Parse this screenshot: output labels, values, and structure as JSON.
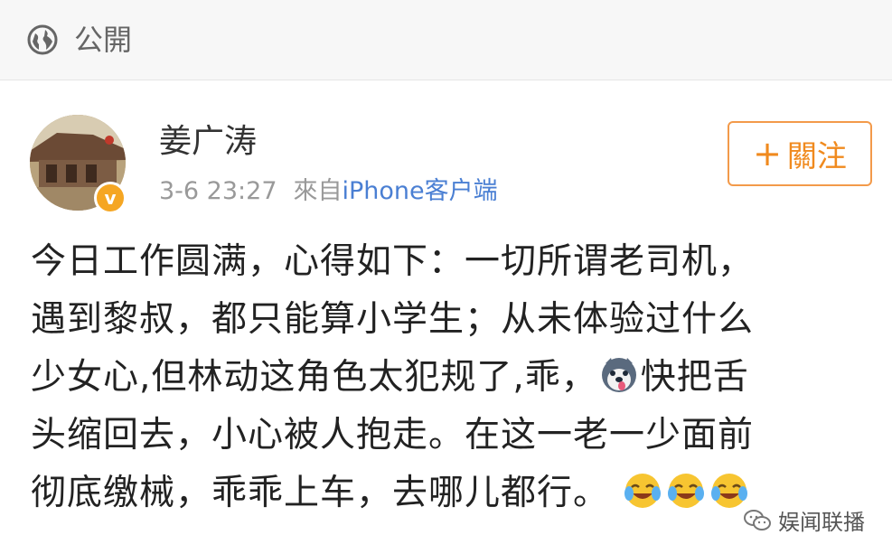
{
  "topbar": {
    "visibility_icon": "globe-icon",
    "visibility_label": "公開"
  },
  "post": {
    "author": {
      "name": "姜广涛",
      "avatar_icon": "avatar",
      "verified_icon": "verified-badge-icon",
      "verified_mark": "v"
    },
    "meta": {
      "time": "3-6 23:27",
      "source_prefix": "來自",
      "source_link": "iPhone客户端"
    },
    "follow_button": {
      "plus": "+",
      "label": "關注"
    },
    "text_lines": [
      "今日工作圆满，心得如下：一切所谓老司机，",
      "遇到黎叔，都只能算小学生；从未体验过什么",
      "少女心,但林动这角色太犯规了,乖，",
      "快把舌",
      "头缩回去，小心被人抱走。在这一老一少面前",
      "彻底缴械，乖乖上车，去哪儿都行。"
    ],
    "emojis": [
      "husky-emoji-icon",
      "laugh-cry-emoji-icon",
      "laugh-cry-emoji-icon",
      "laugh-cry-emoji-icon"
    ]
  },
  "watermark": {
    "icon": "wechat-icon",
    "text": "娱闻联播"
  },
  "colors": {
    "accent_orange": "#f08a1e",
    "link_blue": "#4a7fd3",
    "verified": "#f5a623",
    "meta_gray": "#999999"
  }
}
